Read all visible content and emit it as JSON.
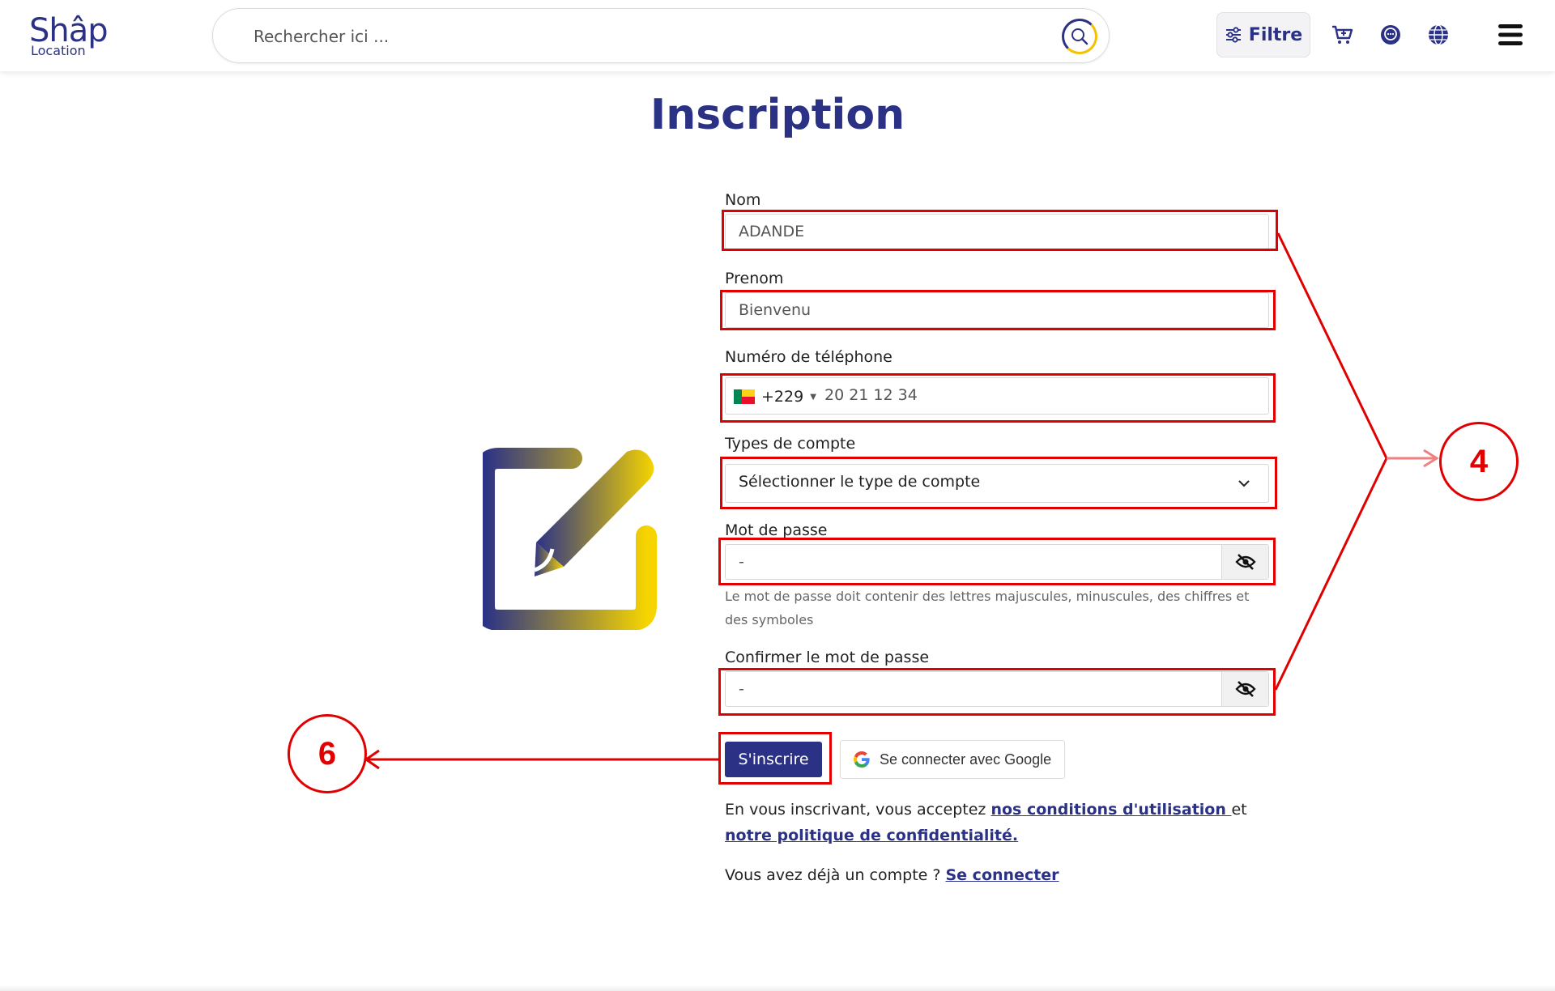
{
  "header": {
    "logo_main": "Shâp",
    "logo_sub": "Location",
    "search_placeholder": "Rechercher ici ...",
    "filter_label": "Filtre",
    "icons": [
      "search-icon",
      "sliders-icon",
      "cart-icon",
      "chat-icon",
      "globe-icon",
      "menu-icon"
    ]
  },
  "page": {
    "title": "Inscription"
  },
  "form": {
    "nom_label": "Nom",
    "nom_value": "ADANDE",
    "prenom_label": "Prenom",
    "prenom_value": "Bienvenu",
    "phone_label": "Numéro de téléphone",
    "phone_code": "+229",
    "phone_value": "20 21 12 34",
    "account_type_label": "Types de compte",
    "account_type_value": "Sélectionner le type de compte",
    "password_label": "Mot de passe",
    "password_value": "-",
    "password_hint": "Le mot de passe doit contenir des lettres majuscules, minuscules, des chiffres et des symboles",
    "confirm_label": "Confirmer le mot de passe",
    "confirm_value": "-",
    "submit_label": "S'inscrire",
    "google_label": "Se connecter avec Google",
    "terms_prefix": "En vous inscrivant, vous acceptez ",
    "terms_link": "nos conditions d'utilisation ",
    "terms_mid": "et",
    "privacy_link": "notre politique de confidentialité.",
    "login_prefix": "Vous avez déjà un compte ? ",
    "login_link": "Se connecter"
  },
  "annotations": {
    "callout_fields": "4",
    "callout_submit": "6",
    "color": "#e00000"
  },
  "colors": {
    "brand": "#2b3286",
    "accent": "#f2c200"
  }
}
